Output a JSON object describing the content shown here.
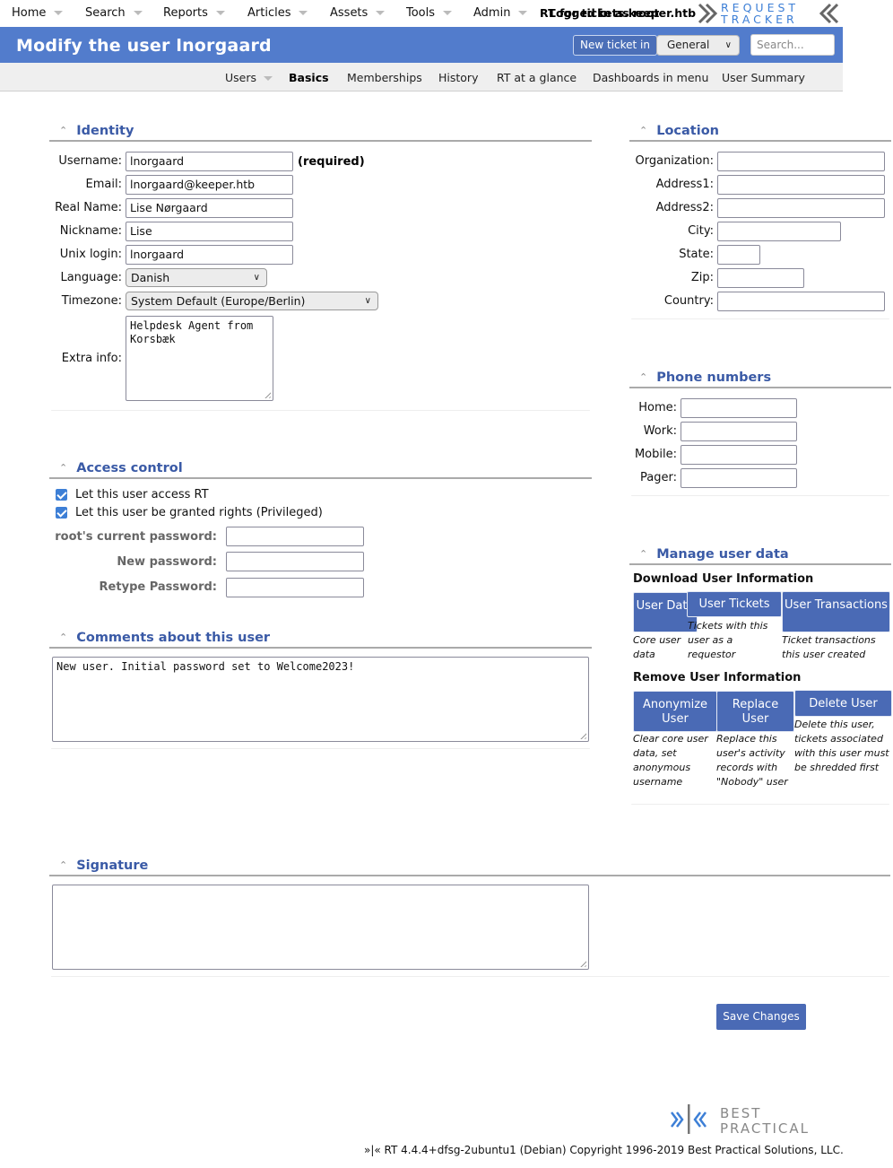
{
  "topnav": {
    "items": [
      "Home",
      "Search",
      "Reports",
      "Articles",
      "Assets",
      "Tools",
      "Admin"
    ],
    "rt_for": "RT for tickets.keeper.htb",
    "logged_in": "Logged in as root",
    "logo": {
      "line1": "REQUEST",
      "line2": "TRACKER"
    }
  },
  "header": {
    "title": "Modify the user lnorgaard",
    "new_ticket_label": "New ticket in",
    "queue_selected": "General",
    "search_placeholder": "Search..."
  },
  "subnav": {
    "items": [
      "Users",
      "Basics",
      "Memberships",
      "History",
      "RT at a glance",
      "Dashboards in menu",
      "User Summary"
    ],
    "active": "Basics"
  },
  "identity": {
    "title": "Identity",
    "username": {
      "label": "Username:",
      "value": "lnorgaard",
      "note": "(required)"
    },
    "email": {
      "label": "Email:",
      "value": "lnorgaard@keeper.htb"
    },
    "realname": {
      "label": "Real Name:",
      "value": "Lise Nørgaard"
    },
    "nickname": {
      "label": "Nickname:",
      "value": "Lise"
    },
    "unixlogin": {
      "label": "Unix login:",
      "value": "lnorgaard"
    },
    "language": {
      "label": "Language:",
      "value": "Danish"
    },
    "timezone": {
      "label": "Timezone:",
      "value": "System Default (Europe/Berlin)"
    },
    "extrainfo": {
      "label": "Extra info:",
      "value": "Helpdesk Agent from\nKorsbæk"
    }
  },
  "access": {
    "title": "Access control",
    "enabled": {
      "label": "Let this user access RT",
      "checked": true
    },
    "privileged": {
      "label": "Let this user be granted rights (Privileged)",
      "checked": true
    },
    "current_pw": {
      "label": "root's current password:",
      "value": ""
    },
    "new_pw": {
      "label": "New password:",
      "value": ""
    },
    "retype_pw": {
      "label": "Retype Password:",
      "value": ""
    }
  },
  "comments": {
    "title": "Comments about this user",
    "value": "New user. Initial password set to Welcome2023!"
  },
  "signature": {
    "title": "Signature",
    "value": ""
  },
  "location": {
    "title": "Location",
    "fields": [
      {
        "label": "Organization:",
        "value": ""
      },
      {
        "label": "Address1:",
        "value": ""
      },
      {
        "label": "Address2:",
        "value": ""
      },
      {
        "label": "City:",
        "value": ""
      },
      {
        "label": "State:",
        "value": ""
      },
      {
        "label": "Zip:",
        "value": ""
      },
      {
        "label": "Country:",
        "value": ""
      }
    ]
  },
  "phones": {
    "title": "Phone numbers",
    "fields": [
      {
        "label": "Home:",
        "value": ""
      },
      {
        "label": "Work:",
        "value": ""
      },
      {
        "label": "Mobile:",
        "value": ""
      },
      {
        "label": "Pager:",
        "value": ""
      }
    ]
  },
  "manage": {
    "title": "Manage user data",
    "download_heading": "Download User Information",
    "download": [
      {
        "label": "User Data",
        "desc": "Core user data"
      },
      {
        "label": "User Tickets",
        "desc": "Tickets with this user as a requestor"
      },
      {
        "label": "User Transactions",
        "desc": "Ticket transactions this user created"
      }
    ],
    "remove_heading": "Remove User Information",
    "remove": [
      {
        "label": "Anonymize User",
        "desc": "Clear core user data, set anonymous username"
      },
      {
        "label": "Replace User",
        "desc": "Replace this user's activity records with \"Nobody\" user"
      },
      {
        "label": "Delete User",
        "desc": "Delete this user, tickets associated with this user must be shredded first"
      }
    ]
  },
  "save_label": "Save Changes",
  "bp_logo": {
    "line1": "BEST",
    "line2": "PRACTICAL"
  },
  "footer": "»|« RT 4.4.4+dfsg-2ubuntu1 (Debian) Copyright 1996-2019 Best Practical Solutions, LLC.",
  "colors": {
    "accent": "#527ccc",
    "button": "#4a6ab5",
    "section_title": "#3a5aa6"
  }
}
